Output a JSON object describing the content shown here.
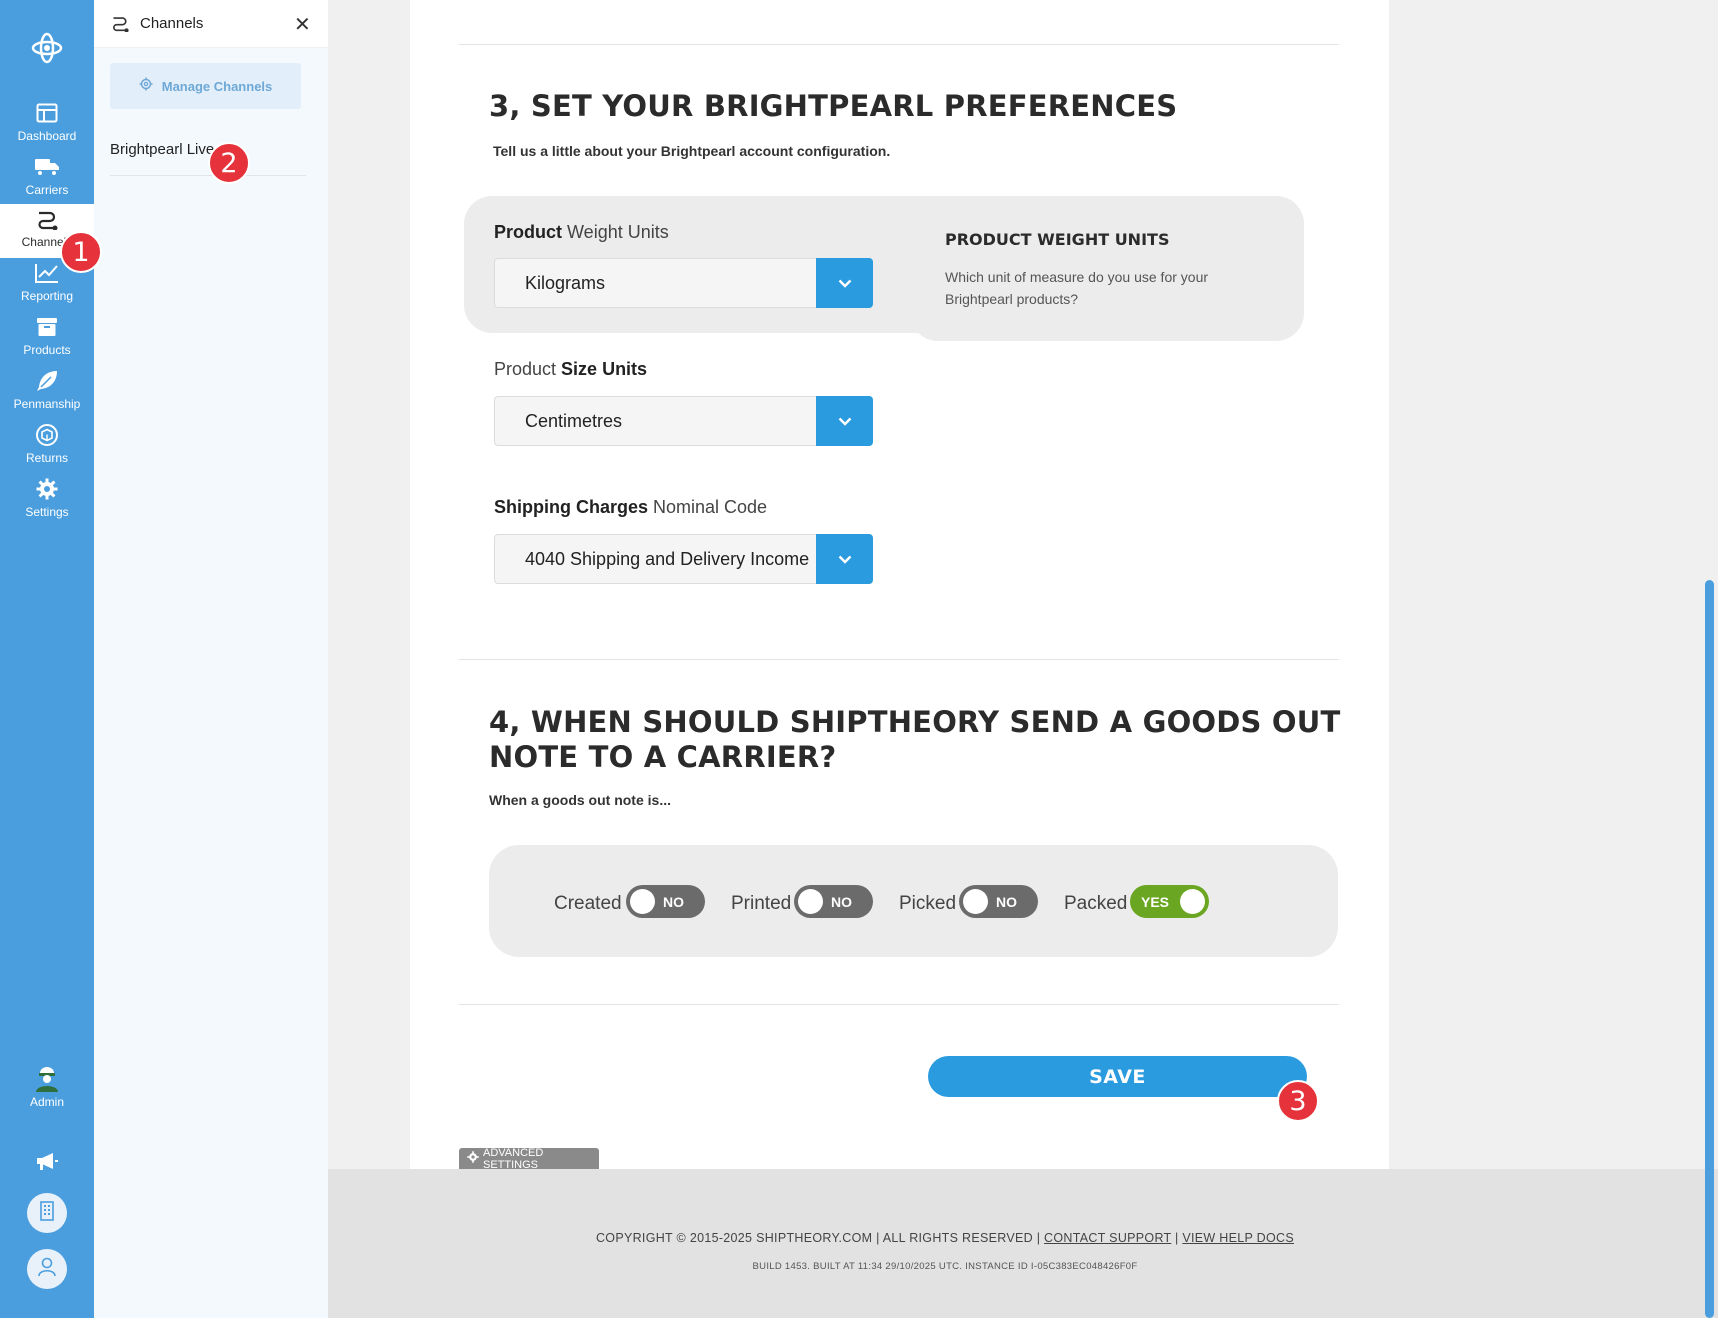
{
  "nav": {
    "items": [
      {
        "label": "Dashboard",
        "icon": "dashboard-icon"
      },
      {
        "label": "Carriers",
        "icon": "truck-icon"
      },
      {
        "label": "Channels",
        "icon": "channels-icon",
        "active": true
      },
      {
        "label": "Reporting",
        "icon": "chart-icon"
      },
      {
        "label": "Products",
        "icon": "box-icon"
      },
      {
        "label": "Penmanship",
        "icon": "feather-icon"
      },
      {
        "label": "Returns",
        "icon": "returns-icon"
      },
      {
        "label": "Settings",
        "icon": "gear-icon"
      }
    ],
    "admin_label": "Admin"
  },
  "panel": {
    "title": "Channels",
    "manage_label": "Manage Channels",
    "channels": [
      "Brightpearl Live"
    ]
  },
  "section3": {
    "title": "3, SET YOUR BRIGHTPEARL PREFERENCES",
    "subtitle": "Tell us a little about your Brightpearl account configuration.",
    "weight": {
      "label_bold": "Product",
      "label_rest": " Weight Units",
      "value": "Kilograms"
    },
    "size": {
      "label_rest": "Product ",
      "label_bold": "Size Units",
      "value": "Centimetres"
    },
    "shipping": {
      "label_bold": "Shipping Charges",
      "label_rest": " Nominal Code",
      "value": "4040 Shipping and Delivery Income"
    },
    "help": {
      "title": "PRODUCT WEIGHT UNITS",
      "text": "Which unit of measure do you use for your Brightpearl products?"
    }
  },
  "section4": {
    "title_line1": "4, WHEN SHOULD SHIPTHEORY SEND A GOODS OUT",
    "title_line2": "NOTE TO A CARRIER?",
    "subtitle": "When a goods out note is...",
    "toggles": [
      {
        "label": "Created",
        "state": "NO",
        "on": false
      },
      {
        "label": "Printed",
        "state": "NO",
        "on": false
      },
      {
        "label": "Picked",
        "state": "NO",
        "on": false
      },
      {
        "label": "Packed",
        "state": "YES",
        "on": true
      }
    ]
  },
  "actions": {
    "save_label": "SAVE",
    "advanced_label": "ADVANCED SETTINGS"
  },
  "footer": {
    "copyright": "COPYRIGHT © 2015-2025 SHIPTHEORY.COM",
    "rights": "ALL RIGHTS RESERVED",
    "contact": "CONTACT SUPPORT",
    "help_docs": "VIEW HELP DOCS",
    "build": "BUILD 1453. BUILT AT 11:34 29/10/2025 UTC. INSTANCE ID I-05C383EC048426F0F"
  },
  "markers": [
    "1",
    "2",
    "3"
  ],
  "colors": {
    "rail": "#4a9ede",
    "accent": "#2b9be0",
    "toggle_on": "#6aa621",
    "toggle_off": "#6b6b6b",
    "marker": "#e5323b"
  }
}
